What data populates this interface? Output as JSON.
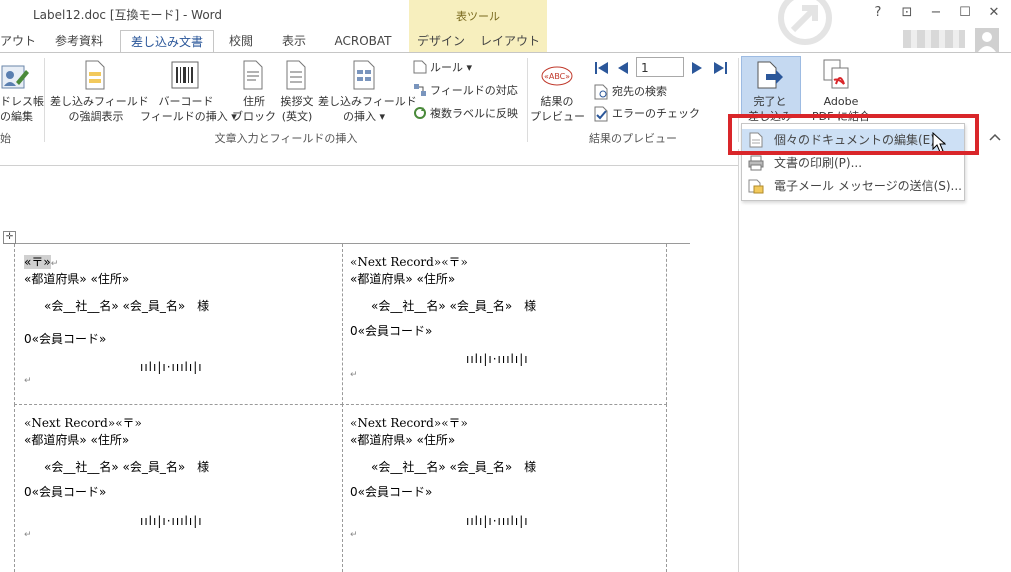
{
  "window": {
    "title": "Label12.doc [互換モード] - Word",
    "context_group": "表ツール",
    "help": "?",
    "ribbon_display": "⊡",
    "minimize": "−",
    "maximize": "☐",
    "close": "✕"
  },
  "tabs": [
    {
      "label": "アウト"
    },
    {
      "label": "参考資料"
    },
    {
      "label": "差し込み文書"
    },
    {
      "label": "校閲"
    },
    {
      "label": "表示"
    },
    {
      "label": "ACROBAT"
    },
    {
      "label": "デザイン"
    },
    {
      "label": "レイアウト"
    }
  ],
  "ribbon": {
    "address_book": [
      "ドレス帳",
      "の編集"
    ],
    "highlight_fields": [
      "差し込みフィールド",
      "の強調表示"
    ],
    "barcode": [
      "バーコード",
      "フィールドの挿入 ▾"
    ],
    "address_block": [
      "住所",
      "ブロック"
    ],
    "greeting": [
      "挨拶文",
      "(英文)"
    ],
    "insert_field": [
      "差し込みフィールド",
      "の挿入 ▾"
    ],
    "rules": "ルール ▾",
    "match_fields": "フィールドの対応",
    "update_labels": "複数ラベルに反映",
    "preview_results": [
      "結果の",
      "プレビュー"
    ],
    "record_number": "1",
    "find_recipient": "宛先の検索",
    "check_errors": "エラーのチェック",
    "finish_merge": [
      "完了と",
      "差し込み"
    ],
    "adobe": [
      "Adobe",
      "PDF に結合"
    ],
    "group_partial": "始",
    "group_write_insert": "文章入力とフィールドの挿入",
    "group_preview": "結果のプレビュー"
  },
  "menu": {
    "items": [
      {
        "label": "個々のドキュメントの編集(E)..."
      },
      {
        "label": "文書の印刷(P)..."
      },
      {
        "label": "電子メール メッセージの送信(S)..."
      }
    ]
  },
  "label": {
    "zip_first": "«〒»",
    "next_zip": "«Next Record»«〒»",
    "address": "«都道府県» «住所»",
    "names": "«会__社__名» «会_員_名»　様",
    "code": "0«会員コード»",
    "barcode": "ıılı|ı·ııılı|ı"
  }
}
